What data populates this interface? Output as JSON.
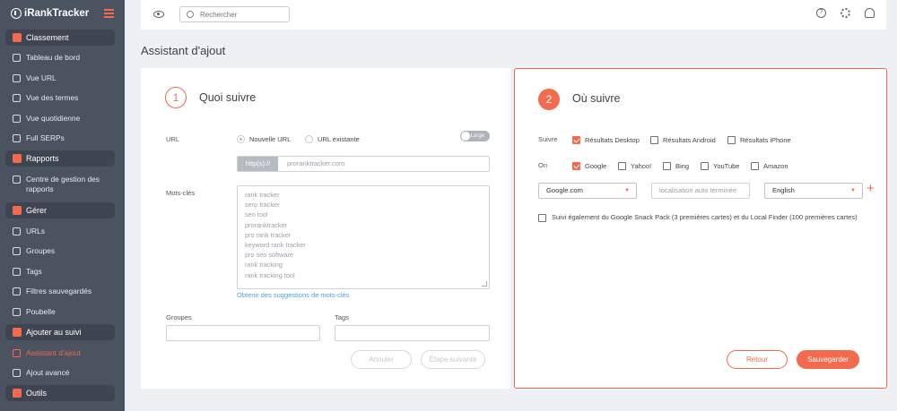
{
  "app": {
    "logo": "RankTracker",
    "logo_prefix": "i"
  },
  "sidebar": {
    "sections": [
      {
        "label": "Classement",
        "items": [
          "Tableau de bord",
          "Vue URL",
          "Vue des termes",
          "Vue quotidienne",
          "Full SERPs"
        ]
      },
      {
        "label": "Rapports",
        "items": [
          "Centre de gestion des rapports"
        ]
      },
      {
        "label": "Gérer",
        "items": [
          "URLs",
          "Groupes",
          "Tags",
          "Filtres sauvegardés",
          "Poubelle"
        ]
      },
      {
        "label": "Ajouter au suivi",
        "items": [
          "Assistant d'ajout",
          "Ajout avancé"
        ]
      },
      {
        "label": "Outils",
        "items": []
      }
    ],
    "active_item": "Assistant d'ajout"
  },
  "topbar": {
    "search_placeholder": "Rechercher"
  },
  "page": {
    "title": "Assistant d'ajout"
  },
  "step1": {
    "number": "1",
    "title": "Quoi suivre",
    "url_label": "URL",
    "radio_new": "Nouvelle URL",
    "radio_existing": "URL existante",
    "selected_radio": "Nouvelle URL",
    "toggle_label": "Large",
    "protocol": "http(s)://",
    "url_placeholder": "proranktracker.com",
    "keywords_label": "Mots-clés",
    "keywords": [
      "rank tracker",
      "serp tracker",
      "seo tool",
      "proranktracker",
      "pro rank tracker",
      "keyword rank tracker",
      "pro seo software",
      "rank tracking",
      "rank tracking tool"
    ],
    "suggestions_link": "Obtenir des suggestions de mots-clés",
    "groups_label": "Groupes",
    "tags_label": "Tags",
    "cancel_button": "Annuler",
    "next_button": "Étape suivante"
  },
  "step2": {
    "number": "2",
    "title": "Où suivre",
    "track_label": "Suivre",
    "track_options": [
      {
        "label": "Résultats Desktop",
        "checked": true
      },
      {
        "label": "Résultats Android",
        "checked": false
      },
      {
        "label": "Résultats iPhone",
        "checked": false
      }
    ],
    "on_label": "On",
    "engines": [
      {
        "label": "Google",
        "checked": true
      },
      {
        "label": "Yahoo!",
        "checked": false
      },
      {
        "label": "Bing",
        "checked": false
      },
      {
        "label": "YouTube",
        "checked": false
      },
      {
        "label": "Amazon",
        "checked": false
      }
    ],
    "search_engine_select": "Google.com",
    "location_placeholder": "localisation auto terminée",
    "language_select": "English",
    "snack_pack_label": "Suivi également du Google Snack Pack (3 premières cartes) et du Local Finder (100 premières cartes)",
    "snack_pack_checked": false,
    "back_button": "Retour",
    "save_button": "Sauvegarder"
  },
  "colors": {
    "accent": "#f26b4f",
    "sidebar": "#4b5260",
    "link": "#4ba3d6"
  },
  "icons": [
    "eye-icon",
    "search-icon",
    "help-icon",
    "gear-icon",
    "user-icon",
    "plus-icon",
    "menu-icon"
  ]
}
